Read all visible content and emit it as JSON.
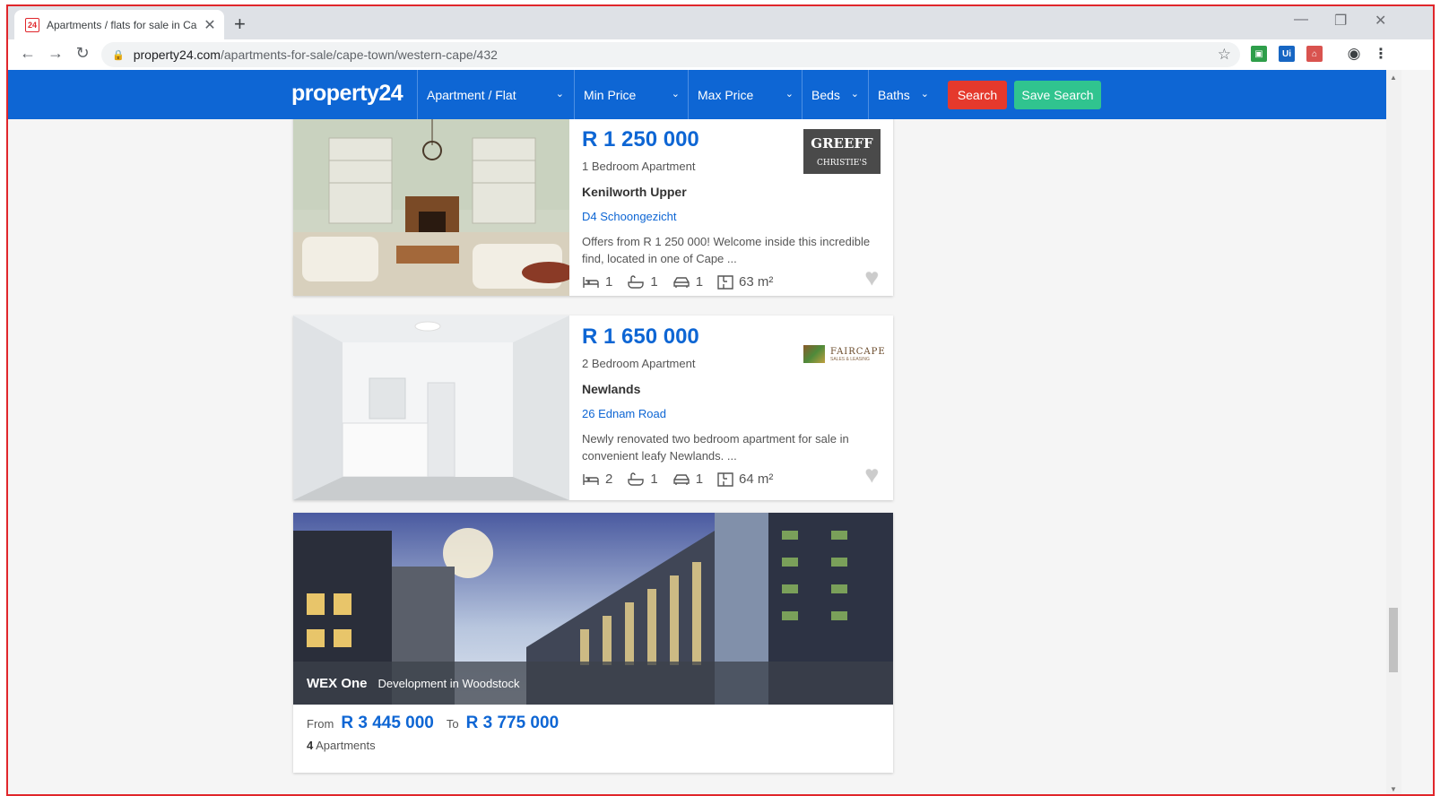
{
  "browser": {
    "tab_title": "Apartments / flats for sale in Cape Town",
    "tab_favicon": "24",
    "url_host": "property24.com",
    "url_path": "/apartments-for-sale/cape-town/western-cape/432",
    "extensions": [
      "grammarly-icon",
      "uipath-icon",
      "acrobat-icon",
      "profile-icon"
    ]
  },
  "nav": {
    "logo": "property24",
    "filters": [
      "Apartment / Flat",
      "Min Price",
      "Max Price",
      "Beds",
      "Baths"
    ],
    "search_label": "Search",
    "save_search_label": "Save Search"
  },
  "listings": [
    {
      "price": "R 1 250 000",
      "type": "1 Bedroom Apartment",
      "suburb": "Kenilworth Upper",
      "address": "D4 Schoongezicht",
      "description": "Offers from R 1 250 000! Welcome inside this incredible find, located in one of Cape ...",
      "beds": "1",
      "baths": "1",
      "parking": "1",
      "size": "63 m²",
      "agency_line1": "GREEFF",
      "agency_line2": "CHRISTIE'S"
    },
    {
      "price": "R 1 650 000",
      "type": "2 Bedroom Apartment",
      "suburb": "Newlands",
      "address": "26 Ednam Road",
      "description": "Newly renovated two bedroom apartment for sale in convenient leafy Newlands. ...",
      "beds": "2",
      "baths": "1",
      "parking": "1",
      "size": "64 m²",
      "agency_line1": "FAIRCAPE",
      "agency_line2": "SALES & LEASING"
    }
  ],
  "development": {
    "name": "WEX One",
    "subtitle": "Development in Woodstock",
    "from_label": "From",
    "from_price": "R 3 445 000",
    "to_label": "To",
    "to_price": "R 3 775 000",
    "units_count": "4",
    "units_label": "Apartments"
  },
  "colors": {
    "brand_blue": "#0e66d4",
    "search_red": "#e5392c",
    "save_green": "#30c48f"
  }
}
